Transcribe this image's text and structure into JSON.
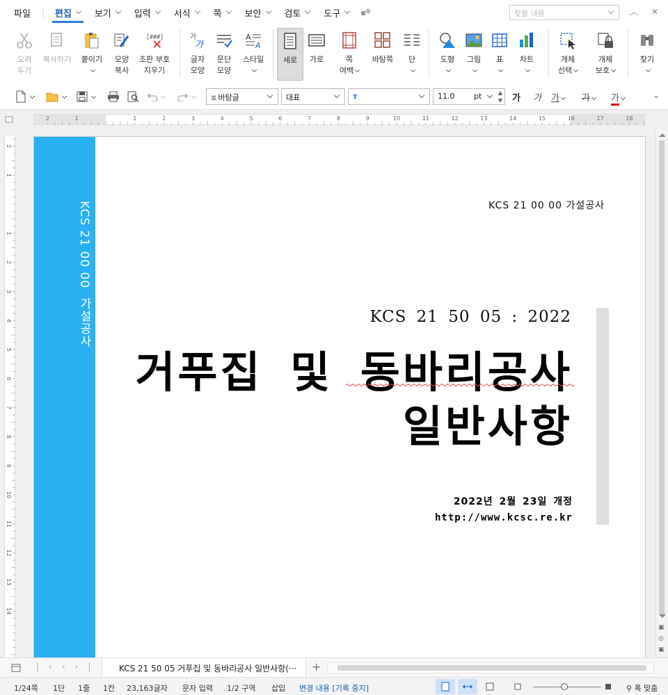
{
  "menu": {
    "file": "파일",
    "items": [
      "편집",
      "보기",
      "입력",
      "서식",
      "쪽",
      "보안",
      "검토",
      "도구"
    ],
    "find_placeholder": "찾을 내용"
  },
  "ribbon": {
    "undo": "오려\n두기",
    "copy": "복사하기",
    "paste": "붙이기",
    "format_copy": "모양\n복사",
    "clear_fmt": "조판 부호\n지우기",
    "char_shape": "글자\n모양",
    "para_shape": "문단\n모양",
    "style": "스타일",
    "portrait": "세로",
    "landscape": "가로",
    "margin": "쪽\n여백",
    "background": "바탕쪽",
    "columns": "단",
    "shape": "도형",
    "picture": "그림",
    "table": "표",
    "chart": "차트",
    "obj_select": "개체\n선택",
    "obj_protect": "개체\n보호",
    "find": "찾기"
  },
  "toolbar2": {
    "style_combo": "바탕글",
    "lang_combo": "대표",
    "font_combo": "",
    "size_value": "11.0",
    "size_unit": "pt",
    "bold": "가",
    "italic": "가",
    "underline": "가",
    "strike": "가",
    "color": "가"
  },
  "ruler": {
    "h_labels": [
      "2",
      "1",
      "1",
      "2",
      "3",
      "4",
      "5",
      "6",
      "7",
      "8",
      "9",
      "10",
      "11",
      "12",
      "13",
      "14",
      "15",
      "16",
      "17",
      "18"
    ],
    "v_labels": [
      "3",
      "2",
      "1",
      "1",
      "2",
      "3",
      "4",
      "5",
      "6",
      "7",
      "8",
      "9",
      "10",
      "11",
      "12",
      "13",
      "14"
    ]
  },
  "document": {
    "side_text": "KCS 21 00 00  가설공사",
    "header": "KCS 21 00 00 가설공사",
    "code": "KCS 21 50 05 : 2022",
    "title_line1": "거푸집 및 동바리공사",
    "title_line2": "일반사항",
    "date": "2022년 2월 23일 개정",
    "url": "http://www.kcsc.re.kr"
  },
  "tabs": {
    "doc_tab": "KCS 21 50 05 거푸집 및 동바리공사 일반사항(···",
    "add": "+"
  },
  "status": {
    "page": "1/24쪽",
    "column": "1단",
    "line": "1줄",
    "cell": "1칸",
    "chars": "23,163글자",
    "mode": "문자 입력",
    "section": "1/2 구역",
    "insert": "삽입",
    "track": "변경 내용 [기록 중지]",
    "fit": "폭 맞춤"
  },
  "colors": {
    "side_strip": "#29b1f3",
    "accent": "#2f7bd9",
    "gray_bar": "#dedede"
  }
}
